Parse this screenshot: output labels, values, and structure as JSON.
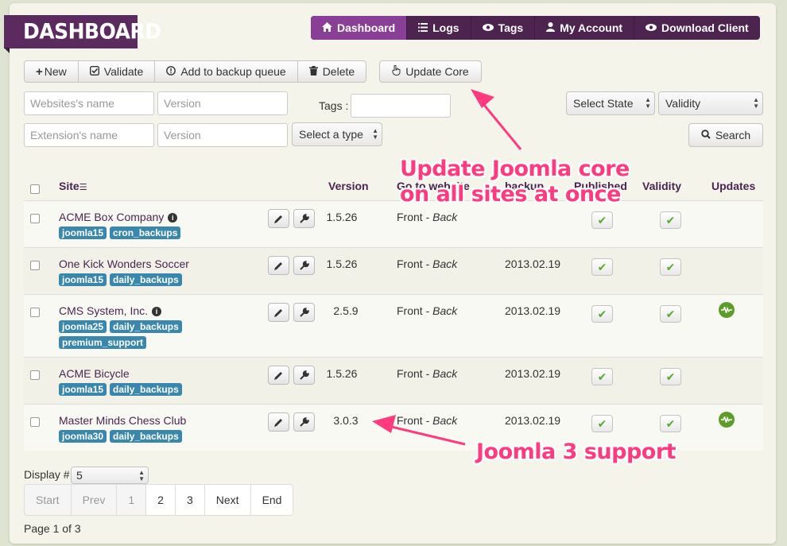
{
  "header": {
    "title": "DASHBOARD"
  },
  "nav": [
    {
      "label": "Dashboard",
      "icon": "home-icon",
      "active": true
    },
    {
      "label": "Logs",
      "icon": "list-icon",
      "active": false
    },
    {
      "label": "Tags",
      "icon": "eye-icon",
      "active": false
    },
    {
      "label": "My Account",
      "icon": "user-icon",
      "active": false
    },
    {
      "label": "Download Client",
      "icon": "eye-icon",
      "active": false
    }
  ],
  "toolbar": {
    "new": "New",
    "validate": "Validate",
    "add_queue": "Add to backup queue",
    "delete": "Delete",
    "update_core": "Update Core"
  },
  "filters": {
    "website_placeholder": "Websites's name",
    "version_placeholder": "Version",
    "tags_label": "Tags :",
    "extension_placeholder": "Extension's name",
    "version2_placeholder": "Version",
    "type_select": "Select a type",
    "state_select": "Select State",
    "validity_select": "Validity",
    "search": "Search"
  },
  "table": {
    "headers": {
      "site": "Site",
      "version": "Version",
      "goto": "Go to website",
      "backup": "backup",
      "published": "Published",
      "validity": "Validity",
      "updates": "Updates"
    },
    "front": "Front",
    "back": "Back",
    "rows": [
      {
        "name": "ACME Box Company",
        "info": true,
        "tags": [
          "joomla15",
          "cron_backups"
        ],
        "version": "1.5.26",
        "backup": "",
        "update": false
      },
      {
        "name": "One Kick Wonders Soccer",
        "info": false,
        "tags": [
          "joomla15",
          "daily_backups"
        ],
        "version": "1.5.26",
        "backup": "2013.02.19",
        "update": false
      },
      {
        "name": "CMS System, Inc.",
        "info": true,
        "tags": [
          "joomla25",
          "daily_backups",
          "premium_support"
        ],
        "version": "2.5.9",
        "backup": "2013.02.19",
        "update": true
      },
      {
        "name": "ACME Bicycle",
        "info": false,
        "tags": [
          "joomla15",
          "daily_backups"
        ],
        "version": "1.5.26",
        "backup": "2013.02.19",
        "update": false
      },
      {
        "name": "Master Minds Chess Club",
        "info": false,
        "tags": [
          "joomla30",
          "daily_backups"
        ],
        "version": "3.0.3",
        "backup": "2013.02.19",
        "update": true
      }
    ]
  },
  "display": {
    "label": "Display #",
    "value": "5"
  },
  "pagination": {
    "start": "Start",
    "prev": "Prev",
    "pages": [
      "1",
      "2",
      "3"
    ],
    "next": "Next",
    "end": "End",
    "summary": "Page 1 of 3"
  },
  "callouts": {
    "update_line1": "Update Joomla core",
    "update_line2": "on all sites at once",
    "joomla3": "Joomla 3 support"
  },
  "colors": {
    "brand": "#5b2a5e",
    "nav_active": "#8a3f96",
    "tag": "#3a87ad",
    "callout": "#ff3a7e",
    "ok": "#5aa92e"
  }
}
